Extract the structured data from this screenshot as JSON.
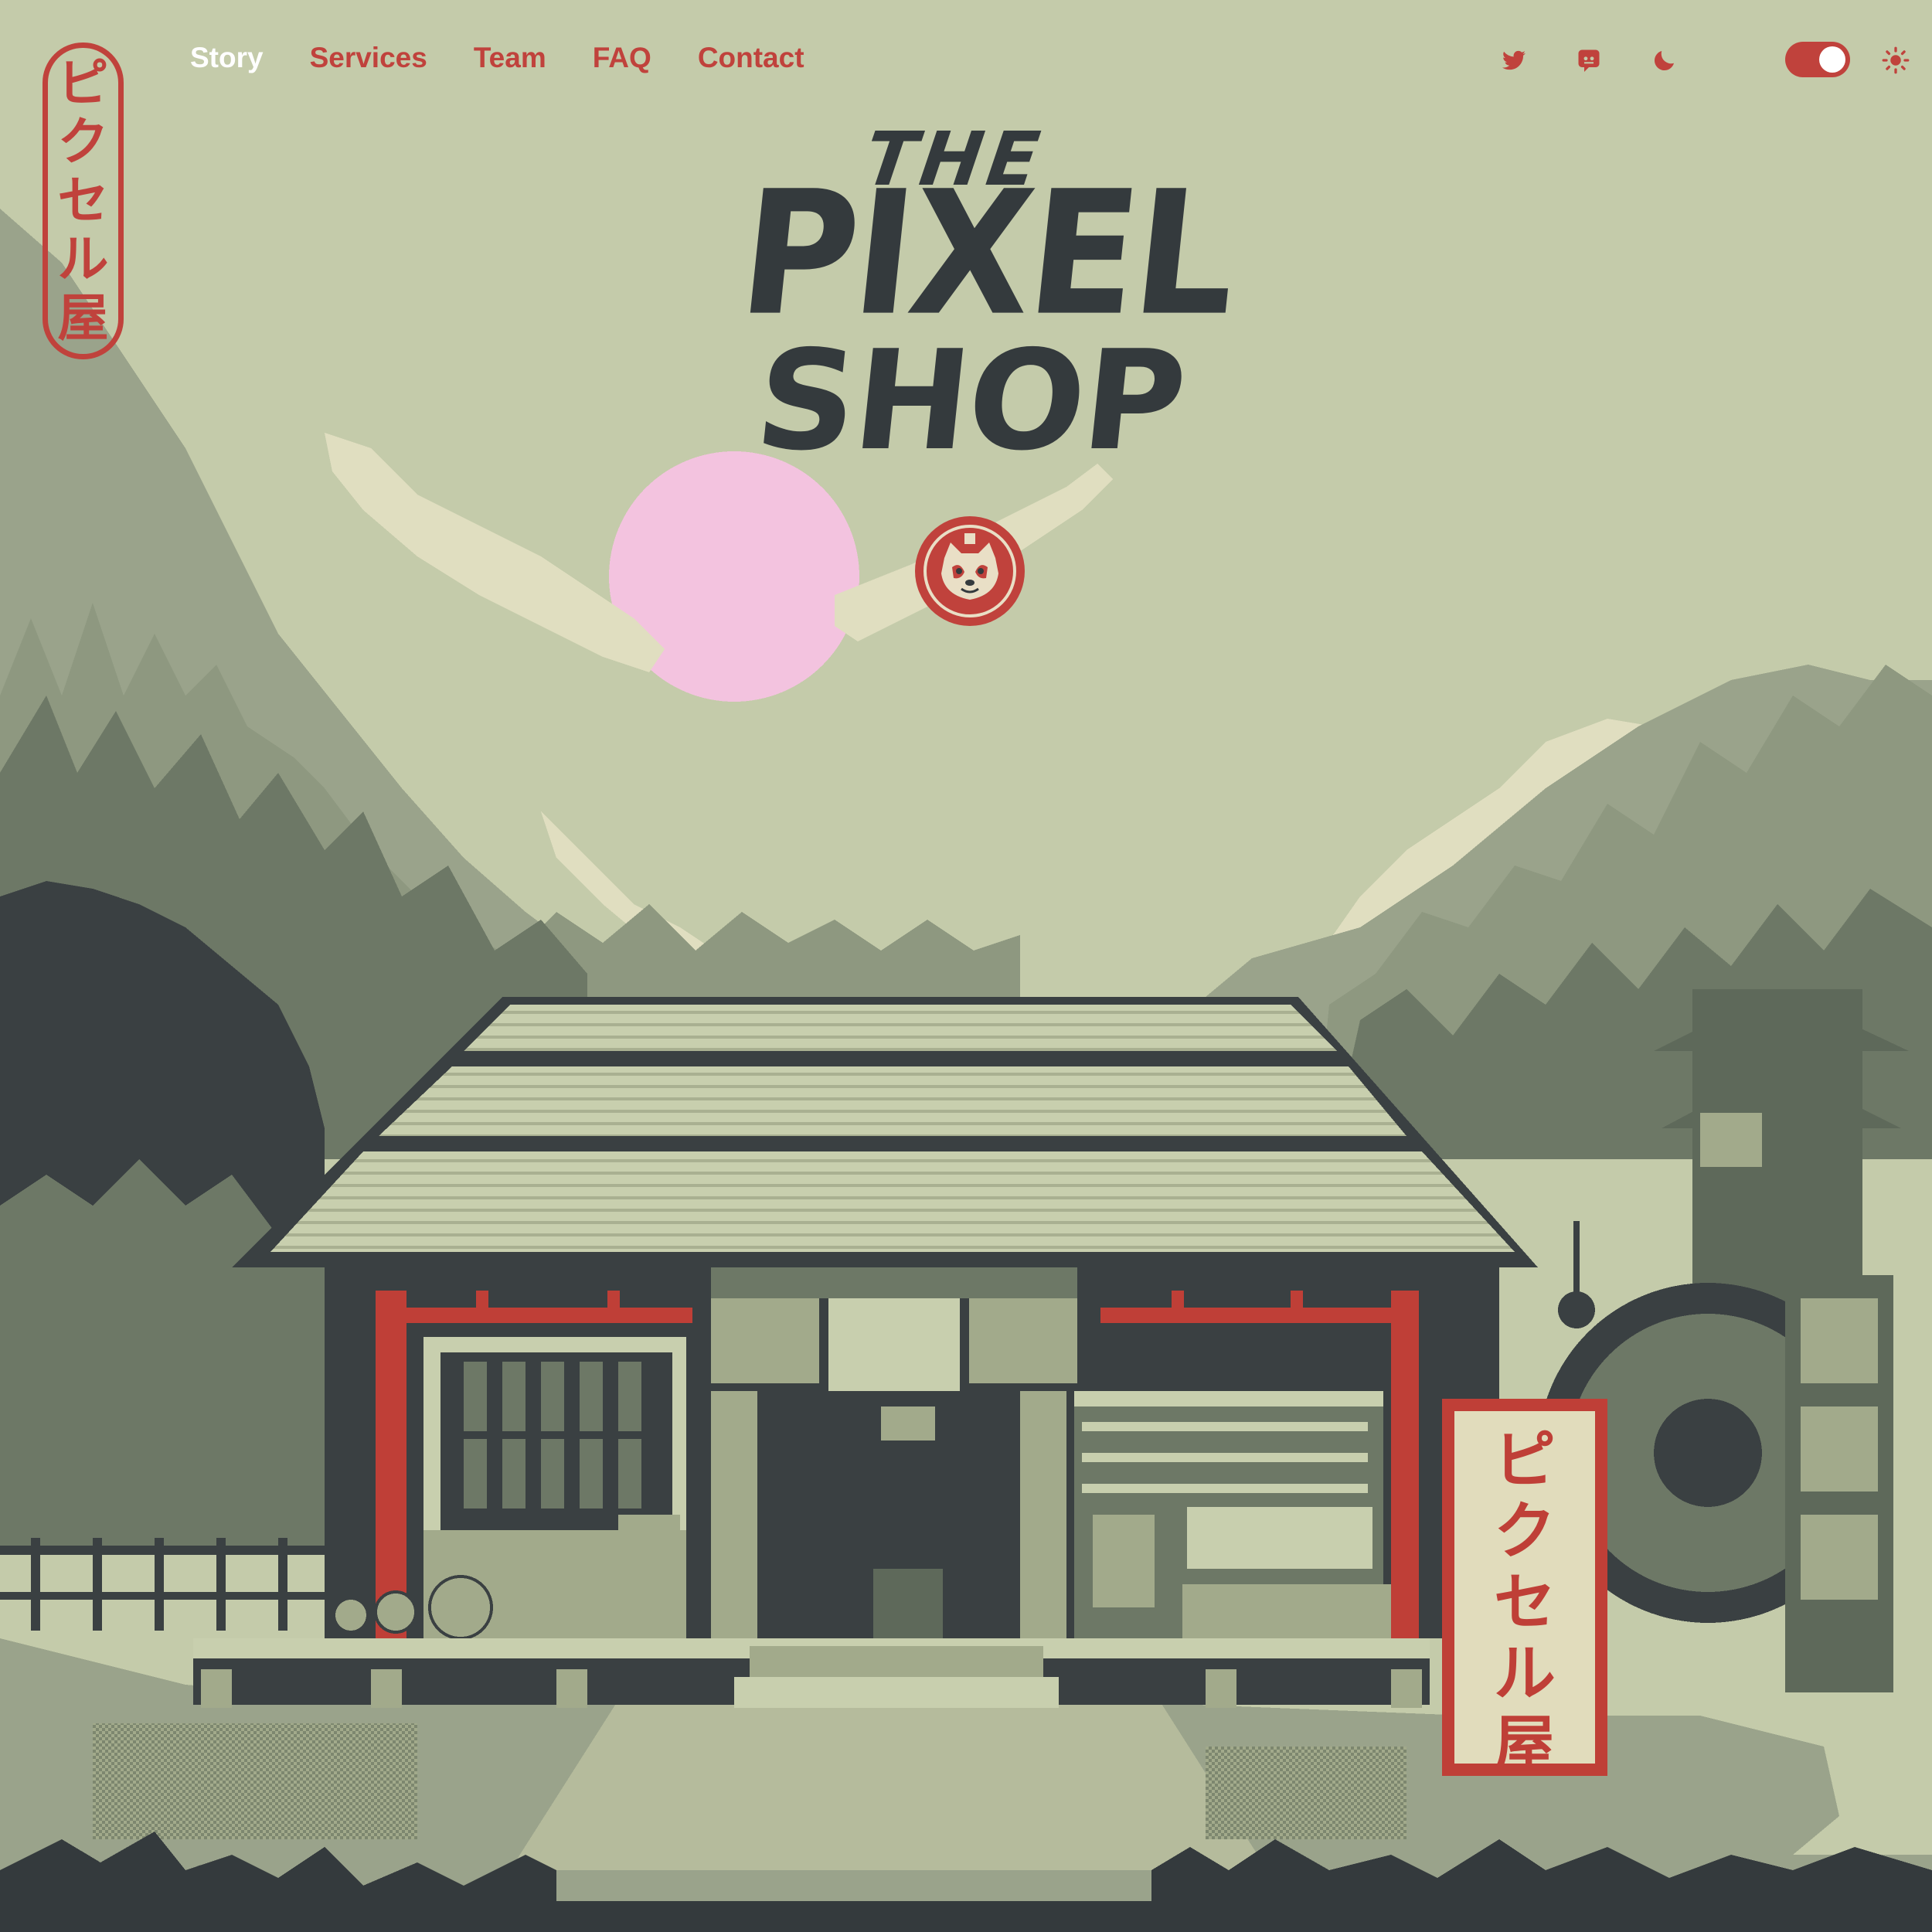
{
  "brand": {
    "vertical_logo_chars": [
      "ピ",
      "ク",
      "セ",
      "ル",
      "屋"
    ],
    "accent_color": "#c0423c",
    "dark_color": "#343a3d",
    "background_color": "#c4cbaa"
  },
  "nav": {
    "items": [
      {
        "label": "Story",
        "active": true
      },
      {
        "label": "Services",
        "active": false
      },
      {
        "label": "Team",
        "active": false
      },
      {
        "label": "FAQ",
        "active": false
      },
      {
        "label": "Contact",
        "active": false
      }
    ]
  },
  "utility": {
    "icons": [
      "twitter-icon",
      "discord-icon",
      "moon-icon",
      "sun-icon"
    ],
    "theme_toggle_on": true
  },
  "hero": {
    "title_line1": "THE",
    "title_line2": "PIXEL",
    "title_line3": "SHOP",
    "badge_icon": "red-panda-icon"
  },
  "scene": {
    "sign_chars": [
      "ピ",
      "ク",
      "セ",
      "ル",
      "屋"
    ]
  }
}
